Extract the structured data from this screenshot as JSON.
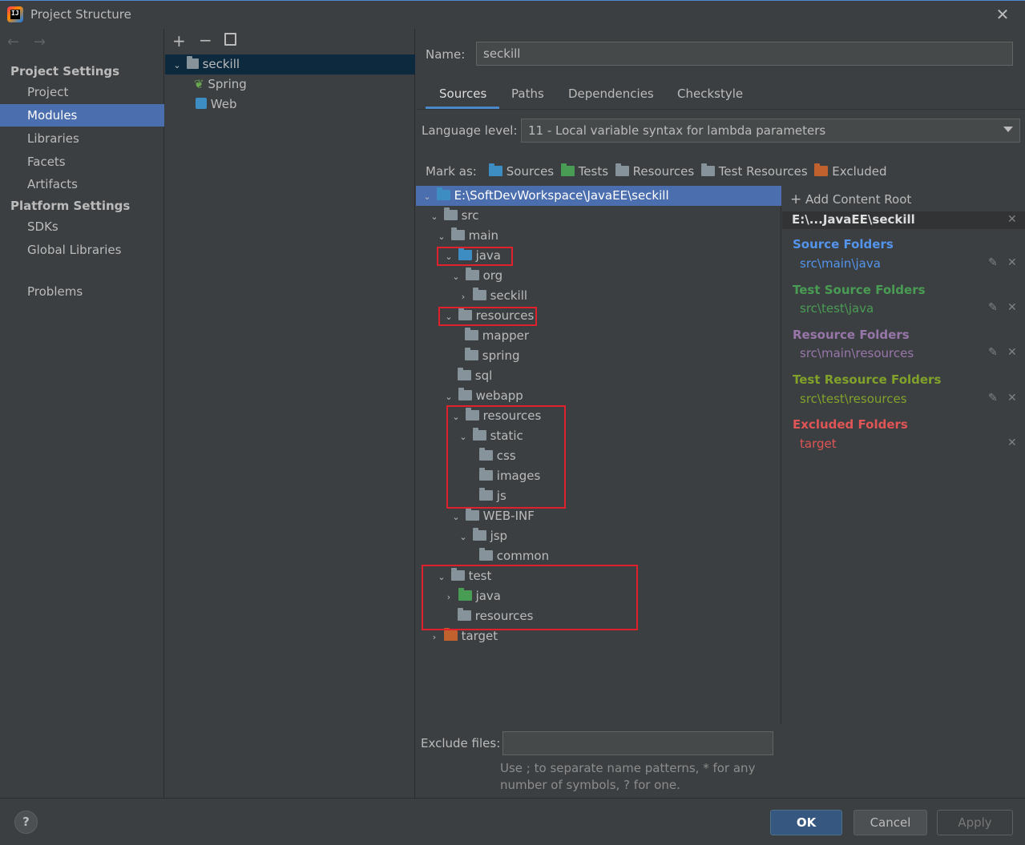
{
  "window": {
    "title": "Project Structure"
  },
  "sidebar": {
    "project_settings_header": "Project Settings",
    "platform_settings_header": "Platform Settings",
    "items": [
      "Project",
      "Modules",
      "Libraries",
      "Facets",
      "Artifacts",
      "SDKs",
      "Global Libraries",
      "Problems"
    ],
    "selected": "Modules"
  },
  "modules": [
    {
      "label": "seckill",
      "icon": "module-icon",
      "selected": true
    },
    {
      "label": "Spring",
      "icon": "spring-leaf-icon"
    },
    {
      "label": "Web",
      "icon": "web-facet-icon"
    }
  ],
  "name_label": "Name:",
  "name_value": "seckill",
  "tabs": [
    "Sources",
    "Paths",
    "Dependencies",
    "Checkstyle"
  ],
  "active_tab": "Sources",
  "language_label": "Language level:",
  "language_value": "11 - Local variable syntax for lambda parameters",
  "mark_as": {
    "label": "Mark as:",
    "items": [
      "Sources",
      "Tests",
      "Resources",
      "Test Resources",
      "Excluded"
    ]
  },
  "tree": {
    "root": "E:\\SoftDevWorkspace\\JavaEE\\seckill",
    "nodes": [
      "src",
      "main",
      "java",
      "org",
      "seckill",
      "resources",
      "mapper",
      "spring",
      "sql",
      "webapp",
      "resources",
      "static",
      "css",
      "images",
      "js",
      "WEB-INF",
      "jsp",
      "common",
      "test",
      "java",
      "resources",
      "target"
    ]
  },
  "exclude_files": {
    "label": "Exclude files:",
    "hint_1": "Use ; to separate name patterns, * for any",
    "hint_2": "number of symbols, ? for one."
  },
  "content_root": {
    "add_label": "Add Content Root",
    "root_label": "E:\\...JavaEE\\seckill",
    "categories": [
      {
        "title": "Source Folders",
        "path": "src\\main\\java",
        "color": "#5394ec"
      },
      {
        "title": "Test Source Folders",
        "path": "src\\test\\java",
        "color": "#499c54"
      },
      {
        "title": "Resource Folders",
        "path": "src\\main\\resources",
        "color": "#9876aa"
      },
      {
        "title": "Test Resource Folders",
        "path": "src\\test\\resources",
        "color": "#80a22b"
      },
      {
        "title": "Excluded Folders",
        "path": "target",
        "color": "#e05555"
      }
    ]
  },
  "buttons": {
    "ok": "OK",
    "cancel": "Cancel",
    "apply": "Apply",
    "help": "?"
  }
}
